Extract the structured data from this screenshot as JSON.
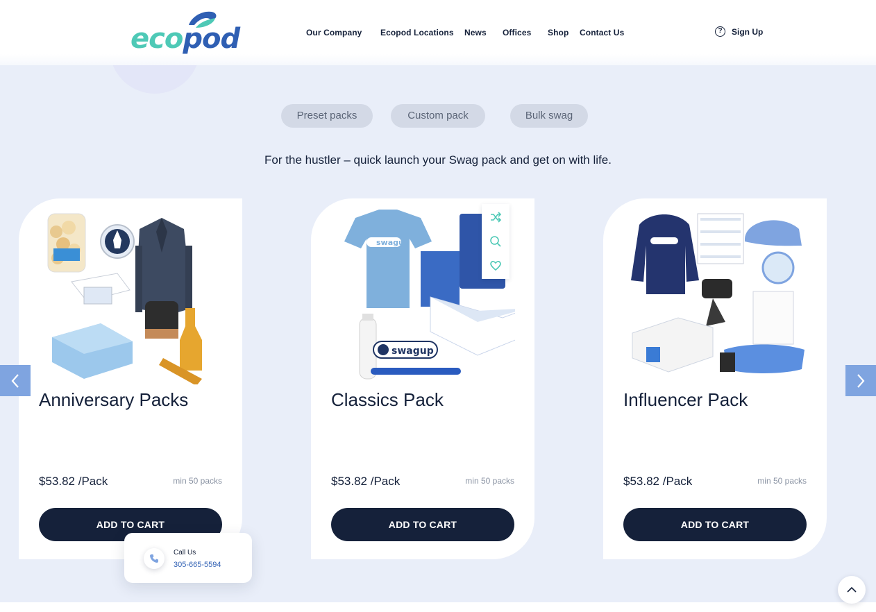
{
  "brand": {
    "logo_eco": "eco",
    "logo_pod": "pod",
    "colors": {
      "teal": "#4ec9b6",
      "blue": "#2f5fb3",
      "navy": "#15213a",
      "page_bg": "#e9eef9",
      "arrow_bg": "#7fa4e0"
    }
  },
  "nav": {
    "items": [
      "Our Company",
      "Ecopod Locations",
      "News",
      "Offices",
      "Shop",
      "Contact Us"
    ],
    "signup_label": "Sign Up",
    "signup_icon": "question-circle-icon"
  },
  "tabs": [
    "Preset packs",
    "Custom pack",
    "Bulk swag"
  ],
  "tagline": "For the hustler – quick launch your Swag pack and get on with life.",
  "products": [
    {
      "title": "Anniversary Packs",
      "price": "$53.82",
      "unit": "/Pack",
      "min": "min 50 packs",
      "button": "ADD TO CART"
    },
    {
      "title": "Classics Pack",
      "price": "$53.82",
      "unit": "/Pack",
      "min": "min 50 packs",
      "button": "ADD TO CART",
      "swag_brand": "swagup"
    },
    {
      "title": "Influencer Pack",
      "price": "$53.82",
      "unit": "/Pack",
      "min": "min 50 packs",
      "button": "ADD TO CART"
    }
  ],
  "card_actions": [
    "shuffle-icon",
    "search-icon",
    "heart-icon"
  ],
  "callus": {
    "label": "Call Us",
    "number": "305-665-5594",
    "icon": "phone-icon"
  },
  "scroll_top_icon": "chevron-up-icon"
}
